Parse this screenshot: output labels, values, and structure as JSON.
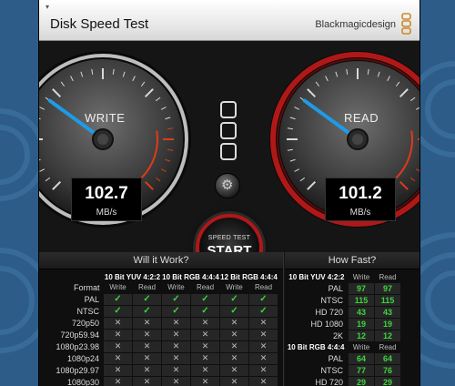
{
  "app": {
    "title": "Disk Speed Test",
    "brand": "Blackmagicdesign",
    "close_glyph": "▾"
  },
  "gauges": {
    "write": {
      "label": "WRITE",
      "value": "102.7",
      "unit": "MB/s",
      "needle_fraction": 0.3
    },
    "read": {
      "label": "READ",
      "value": "101.2",
      "unit": "MB/s",
      "needle_fraction": 0.3
    }
  },
  "start_button": {
    "small": "SPEED TEST",
    "big": "START"
  },
  "settings_icon": "gear-icon",
  "will_it_work": {
    "title": "Will it Work?",
    "format_label": "Format",
    "groups": [
      "10 Bit YUV 4:2:2",
      "10 Bit RGB 4:4:4",
      "12 Bit RGB 4:4:4"
    ],
    "sub_headers": [
      "Write",
      "Read"
    ],
    "rows": [
      {
        "format": "PAL",
        "cells": [
          true,
          true,
          true,
          true,
          true,
          true
        ]
      },
      {
        "format": "NTSC",
        "cells": [
          true,
          true,
          true,
          true,
          true,
          true
        ]
      },
      {
        "format": "720p50",
        "cells": [
          false,
          false,
          false,
          false,
          false,
          false
        ]
      },
      {
        "format": "720p59.94",
        "cells": [
          false,
          false,
          false,
          false,
          false,
          false
        ]
      },
      {
        "format": "1080p23.98",
        "cells": [
          false,
          false,
          false,
          false,
          false,
          false
        ]
      },
      {
        "format": "1080p24",
        "cells": [
          false,
          false,
          false,
          false,
          false,
          false
        ]
      },
      {
        "format": "1080p29.97",
        "cells": [
          false,
          false,
          false,
          false,
          false,
          false
        ]
      },
      {
        "format": "1080p30",
        "cells": [
          false,
          false,
          false,
          false,
          false,
          false
        ]
      }
    ]
  },
  "how_fast": {
    "title": "How Fast?",
    "sections": [
      {
        "group": "10 Bit YUV 4:2:2",
        "sub_headers": [
          "Write",
          "Read"
        ],
        "rows": [
          {
            "label": "PAL",
            "write": "97",
            "read": "97"
          },
          {
            "label": "NTSC",
            "write": "115",
            "read": "115"
          },
          {
            "label": "HD 720",
            "write": "43",
            "read": "43"
          },
          {
            "label": "HD 1080",
            "write": "19",
            "read": "19"
          },
          {
            "label": "2K",
            "write": "12",
            "read": "12"
          }
        ]
      },
      {
        "group": "10 Bit RGB 4:4:4",
        "sub_headers": [
          "Write",
          "Read"
        ],
        "rows": [
          {
            "label": "PAL",
            "write": "64",
            "read": "64"
          },
          {
            "label": "NTSC",
            "write": "77",
            "read": "76"
          },
          {
            "label": "HD 720",
            "write": "29",
            "read": "29"
          }
        ]
      }
    ]
  },
  "colors": {
    "desktop": "#2d5c88",
    "needle": "#1e9be8",
    "read_ring": "#b01818",
    "check": "#3bd63b",
    "value_green": "#3bd63b"
  }
}
